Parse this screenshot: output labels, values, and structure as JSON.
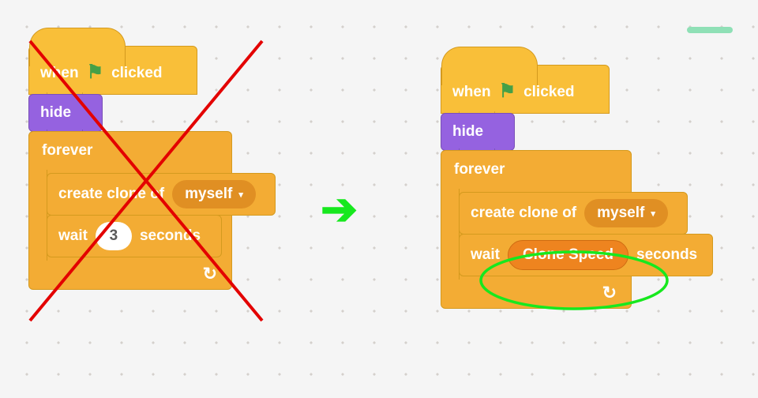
{
  "left": {
    "hat_pre": "when",
    "hat_post": "clicked",
    "hide": "hide",
    "forever": "forever",
    "clone_lbl": "create clone of",
    "clone_opt": "myself",
    "wait_lbl": "wait",
    "wait_val": "3",
    "wait_unit": "seconds"
  },
  "right": {
    "hat_pre": "when",
    "hat_post": "clicked",
    "hide": "hide",
    "forever": "forever",
    "clone_lbl": "create clone of",
    "clone_opt": "myself",
    "wait_lbl": "wait",
    "wait_var": "Clone Speed",
    "wait_unit": "seconds"
  },
  "icons": {
    "flag": "⚑",
    "dropdown": "▾",
    "loop": "↻",
    "arrow": "➔"
  }
}
